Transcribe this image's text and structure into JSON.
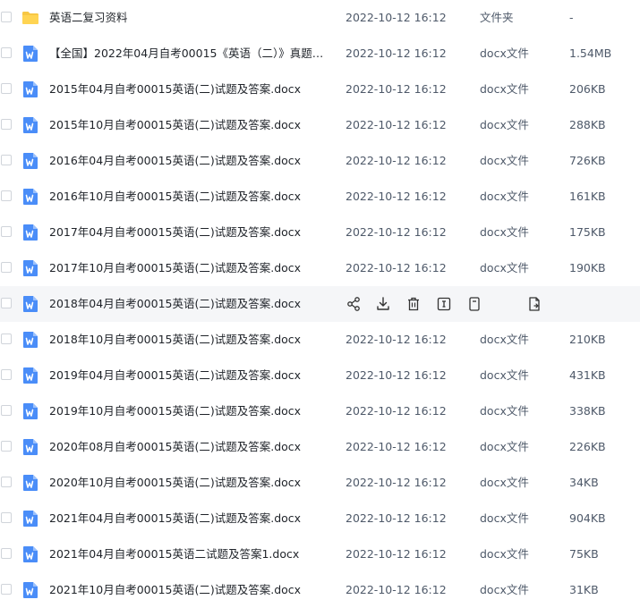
{
  "colors": {
    "folder": "#f7c744",
    "doc": "#4a8df8",
    "hover_bg": "#f5f6f8",
    "icon_stroke": "#333333"
  },
  "hover_actions": [
    "share-icon",
    "download-icon",
    "delete-icon",
    "rename-icon",
    "move-icon",
    "copy-icon"
  ],
  "files": [
    {
      "name": "英语二复习资料",
      "date": "2022-10-12 16:12",
      "type": "文件夹",
      "size": "-",
      "icon": "folder-icon"
    },
    {
      "name": "【全国】2022年04月自考00015《英语（二）》真题及...",
      "date": "2022-10-12 16:12",
      "type": "docx文件",
      "size": "1.54MB",
      "icon": "word-doc-icon"
    },
    {
      "name": "2015年04月自考00015英语(二)试题及答案.docx",
      "date": "2022-10-12 16:12",
      "type": "docx文件",
      "size": "206KB",
      "icon": "word-doc-icon"
    },
    {
      "name": "2015年10月自考00015英语(二)试题及答案.docx",
      "date": "2022-10-12 16:12",
      "type": "docx文件",
      "size": "288KB",
      "icon": "word-doc-icon"
    },
    {
      "name": "2016年04月自考00015英语(二)试题及答案.docx",
      "date": "2022-10-12 16:12",
      "type": "docx文件",
      "size": "726KB",
      "icon": "word-doc-icon"
    },
    {
      "name": "2016年10月自考00015英语(二)试题及答案.docx",
      "date": "2022-10-12 16:12",
      "type": "docx文件",
      "size": "161KB",
      "icon": "word-doc-icon"
    },
    {
      "name": "2017年04月自考00015英语(二)试题及答案.docx",
      "date": "2022-10-12 16:12",
      "type": "docx文件",
      "size": "175KB",
      "icon": "word-doc-icon"
    },
    {
      "name": "2017年10月自考00015英语(二)试题及答案.docx",
      "date": "2022-10-12 16:12",
      "type": "docx文件",
      "size": "190KB",
      "icon": "word-doc-icon"
    },
    {
      "name": "2018年04月自考00015英语(二)试题及答案.docx",
      "date": "",
      "type": "",
      "size": "",
      "icon": "word-doc-icon",
      "hovered": true
    },
    {
      "name": "2018年10月自考00015英语(二)试题及答案.docx",
      "date": "2022-10-12 16:12",
      "type": "docx文件",
      "size": "210KB",
      "icon": "word-doc-icon"
    },
    {
      "name": "2019年04月自考00015英语(二)试题及答案.docx",
      "date": "2022-10-12 16:12",
      "type": "docx文件",
      "size": "431KB",
      "icon": "word-doc-icon"
    },
    {
      "name": "2019年10月自考00015英语(二)试题及答案.docx",
      "date": "2022-10-12 16:12",
      "type": "docx文件",
      "size": "338KB",
      "icon": "word-doc-icon"
    },
    {
      "name": "2020年08月自考00015英语(二)试题及答案.docx",
      "date": "2022-10-12 16:12",
      "type": "docx文件",
      "size": "226KB",
      "icon": "word-doc-icon"
    },
    {
      "name": "2020年10月自考00015英语(二)试题及答案.docx",
      "date": "2022-10-12 16:12",
      "type": "docx文件",
      "size": "34KB",
      "icon": "word-doc-icon"
    },
    {
      "name": "2021年04月自考00015英语(二)试题及答案.docx",
      "date": "2022-10-12 16:12",
      "type": "docx文件",
      "size": "904KB",
      "icon": "word-doc-icon"
    },
    {
      "name": "2021年04月自考00015英语二试题及答案1.docx",
      "date": "2022-10-12 16:12",
      "type": "docx文件",
      "size": "75KB",
      "icon": "word-doc-icon"
    },
    {
      "name": "2021年10月自考00015英语(二)试题及答案.docx",
      "date": "2022-10-12 16:12",
      "type": "docx文件",
      "size": "31KB",
      "icon": "word-doc-icon"
    }
  ]
}
